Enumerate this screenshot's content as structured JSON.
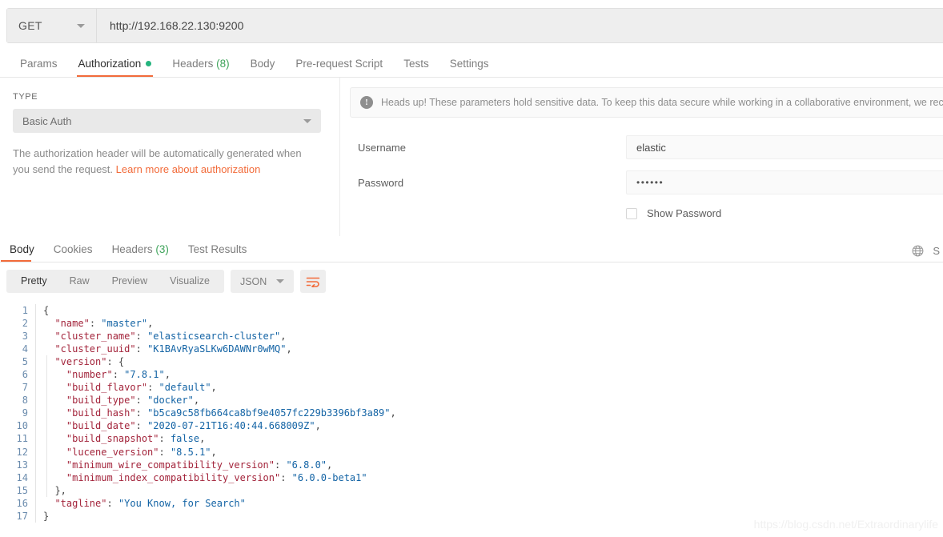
{
  "request": {
    "method": "GET",
    "url": "http://192.168.22.130:9200",
    "tabs": [
      {
        "label": "Params",
        "active": false,
        "dot": false,
        "count": ""
      },
      {
        "label": "Authorization",
        "active": true,
        "dot": true,
        "count": ""
      },
      {
        "label": "Headers",
        "active": false,
        "dot": false,
        "count": "(8)"
      },
      {
        "label": "Body",
        "active": false,
        "dot": false,
        "count": ""
      },
      {
        "label": "Pre-request Script",
        "active": false,
        "dot": false,
        "count": ""
      },
      {
        "label": "Tests",
        "active": false,
        "dot": false,
        "count": ""
      },
      {
        "label": "Settings",
        "active": false,
        "dot": false,
        "count": ""
      }
    ]
  },
  "auth": {
    "type_label": "TYPE",
    "type_value": "Basic Auth",
    "note_text": "The authorization header will be automatically generated when you send the request. ",
    "note_link": "Learn more about authorization",
    "notice": "Heads up! These parameters hold sensitive data. To keep this data secure while working in a collaborative environment, we rec",
    "notice_icon": "exclamation-circle-icon",
    "username_label": "Username",
    "username_value": "elastic",
    "password_label": "Password",
    "password_value": "••••••",
    "show_password_label": "Show Password"
  },
  "response": {
    "tabs": [
      {
        "label": "Body",
        "active": true,
        "count": ""
      },
      {
        "label": "Cookies",
        "active": false,
        "count": ""
      },
      {
        "label": "Headers",
        "active": false,
        "count": "(3)"
      },
      {
        "label": "Test Results",
        "active": false,
        "count": ""
      }
    ],
    "right_icon": "globe-icon",
    "right_text": "S",
    "view_modes": [
      {
        "label": "Pretty",
        "active": true
      },
      {
        "label": "Raw",
        "active": false
      },
      {
        "label": "Preview",
        "active": false
      },
      {
        "label": "Visualize",
        "active": false
      }
    ],
    "format": "JSON",
    "wrap_icon": "word-wrap-icon",
    "line_numbers": [
      1,
      2,
      3,
      4,
      5,
      6,
      7,
      8,
      9,
      10,
      11,
      12,
      13,
      14,
      15,
      16,
      17
    ],
    "body_lines": [
      [
        {
          "t": "{",
          "c": "p"
        }
      ],
      [
        {
          "t": "  ",
          "c": "p"
        },
        {
          "t": "\"name\"",
          "c": "k"
        },
        {
          "t": ": ",
          "c": "p"
        },
        {
          "t": "\"master\"",
          "c": "s"
        },
        {
          "t": ",",
          "c": "p"
        }
      ],
      [
        {
          "t": "  ",
          "c": "p"
        },
        {
          "t": "\"cluster_name\"",
          "c": "k"
        },
        {
          "t": ": ",
          "c": "p"
        },
        {
          "t": "\"elasticsearch-cluster\"",
          "c": "s"
        },
        {
          "t": ",",
          "c": "p"
        }
      ],
      [
        {
          "t": "  ",
          "c": "p"
        },
        {
          "t": "\"cluster_uuid\"",
          "c": "k"
        },
        {
          "t": ": ",
          "c": "p"
        },
        {
          "t": "\"K1BAvRyaSLKw6DAWNr0wMQ\"",
          "c": "s"
        },
        {
          "t": ",",
          "c": "p"
        }
      ],
      [
        {
          "t": "  ",
          "c": "p"
        },
        {
          "t": "\"version\"",
          "c": "k"
        },
        {
          "t": ": {",
          "c": "p"
        }
      ],
      [
        {
          "t": "    ",
          "c": "p"
        },
        {
          "t": "\"number\"",
          "c": "k"
        },
        {
          "t": ": ",
          "c": "p"
        },
        {
          "t": "\"7.8.1\"",
          "c": "s"
        },
        {
          "t": ",",
          "c": "p"
        }
      ],
      [
        {
          "t": "    ",
          "c": "p"
        },
        {
          "t": "\"build_flavor\"",
          "c": "k"
        },
        {
          "t": ": ",
          "c": "p"
        },
        {
          "t": "\"default\"",
          "c": "s"
        },
        {
          "t": ",",
          "c": "p"
        }
      ],
      [
        {
          "t": "    ",
          "c": "p"
        },
        {
          "t": "\"build_type\"",
          "c": "k"
        },
        {
          "t": ": ",
          "c": "p"
        },
        {
          "t": "\"docker\"",
          "c": "s"
        },
        {
          "t": ",",
          "c": "p"
        }
      ],
      [
        {
          "t": "    ",
          "c": "p"
        },
        {
          "t": "\"build_hash\"",
          "c": "k"
        },
        {
          "t": ": ",
          "c": "p"
        },
        {
          "t": "\"b5ca9c58fb664ca8bf9e4057fc229b3396bf3a89\"",
          "c": "s"
        },
        {
          "t": ",",
          "c": "p"
        }
      ],
      [
        {
          "t": "    ",
          "c": "p"
        },
        {
          "t": "\"build_date\"",
          "c": "k"
        },
        {
          "t": ": ",
          "c": "p"
        },
        {
          "t": "\"2020-07-21T16:40:44.668009Z\"",
          "c": "s"
        },
        {
          "t": ",",
          "c": "p"
        }
      ],
      [
        {
          "t": "    ",
          "c": "p"
        },
        {
          "t": "\"build_snapshot\"",
          "c": "k"
        },
        {
          "t": ": ",
          "c": "p"
        },
        {
          "t": "false",
          "c": "b"
        },
        {
          "t": ",",
          "c": "p"
        }
      ],
      [
        {
          "t": "    ",
          "c": "p"
        },
        {
          "t": "\"lucene_version\"",
          "c": "k"
        },
        {
          "t": ": ",
          "c": "p"
        },
        {
          "t": "\"8.5.1\"",
          "c": "s"
        },
        {
          "t": ",",
          "c": "p"
        }
      ],
      [
        {
          "t": "    ",
          "c": "p"
        },
        {
          "t": "\"minimum_wire_compatibility_version\"",
          "c": "k"
        },
        {
          "t": ": ",
          "c": "p"
        },
        {
          "t": "\"6.8.0\"",
          "c": "s"
        },
        {
          "t": ",",
          "c": "p"
        }
      ],
      [
        {
          "t": "    ",
          "c": "p"
        },
        {
          "t": "\"minimum_index_compatibility_version\"",
          "c": "k"
        },
        {
          "t": ": ",
          "c": "p"
        },
        {
          "t": "\"6.0.0-beta1\"",
          "c": "s"
        }
      ],
      [
        {
          "t": "  },",
          "c": "p"
        }
      ],
      [
        {
          "t": "  ",
          "c": "p"
        },
        {
          "t": "\"tagline\"",
          "c": "k"
        },
        {
          "t": ": ",
          "c": "p"
        },
        {
          "t": "\"You Know, for Search\"",
          "c": "s"
        }
      ],
      [
        {
          "t": "}",
          "c": "p"
        }
      ]
    ]
  },
  "watermark": "https://blog.csdn.net/Extraordinarylife",
  "colors": {
    "accent": "#f26b3a",
    "green": "#24b47e",
    "count_green": "#3fa45b",
    "json_key": "#a3243b",
    "json_string": "#1464a5"
  }
}
